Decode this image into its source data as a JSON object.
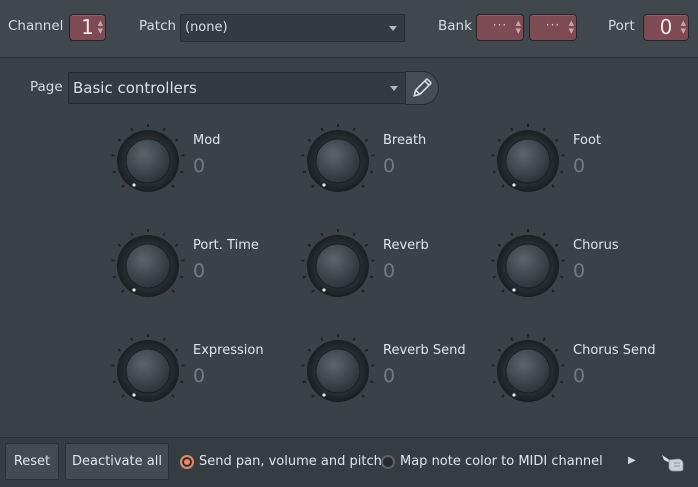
{
  "header": {
    "channel_label": "Channel",
    "channel_value": "1",
    "patch_label": "Patch",
    "patch_value": "(none)",
    "bank_label": "Bank",
    "bank_msb_value": "···",
    "bank_lsb_value": "···",
    "port_label": "Port",
    "port_value": "0"
  },
  "page": {
    "label": "Page",
    "selected": "Basic controllers"
  },
  "knobs": [
    {
      "name": "Mod",
      "value": "0"
    },
    {
      "name": "Breath",
      "value": "0"
    },
    {
      "name": "Foot",
      "value": "0"
    },
    {
      "name": "Port. Time",
      "value": "0"
    },
    {
      "name": "Reverb",
      "value": "0"
    },
    {
      "name": "Chorus",
      "value": "0"
    },
    {
      "name": "Expression",
      "value": "0"
    },
    {
      "name": "Reverb Send",
      "value": "0"
    },
    {
      "name": "Chorus Send",
      "value": "0"
    }
  ],
  "footer": {
    "reset_label": "Reset",
    "deactivate_label": "Deactivate all",
    "send_pan_label": "Send pan, volume and pitch",
    "send_pan_checked": true,
    "map_color_label": "Map note color to MIDI channel",
    "map_color_checked": false
  },
  "colors": {
    "accent_spin": "#7e4b55",
    "radio_on": "#f28a66",
    "background": "#3a4147"
  },
  "icons": [
    "pencil-icon",
    "arrow-right-icon",
    "hand-pointer-icon"
  ]
}
